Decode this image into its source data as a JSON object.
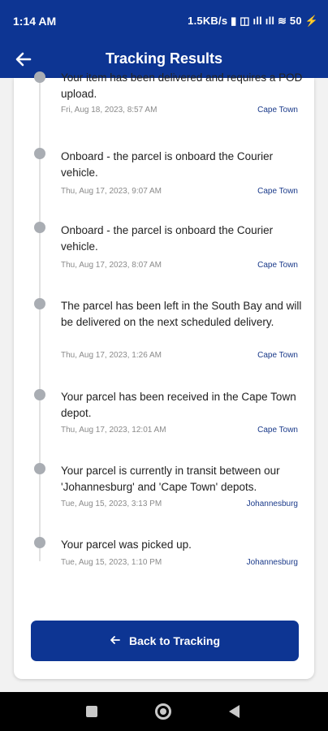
{
  "status": {
    "time": "1:14 AM",
    "right": "1.5KB/s  ▮  ◫ ıll ıll ≋ 50 ⚡"
  },
  "header": {
    "title": "Tracking Results"
  },
  "events": [
    {
      "description": "Your item has been delivered and requires a POD upload.",
      "date": "Fri, Aug 18, 2023, 8:57 AM",
      "location": "Cape Town"
    },
    {
      "description": "Onboard - the parcel is onboard the Courier vehicle.",
      "date": "Thu, Aug 17, 2023, 9:07 AM",
      "location": "Cape Town"
    },
    {
      "description": "Onboard - the parcel is onboard the Courier vehicle.",
      "date": "Thu, Aug 17, 2023, 8:07 AM",
      "location": "Cape Town"
    },
    {
      "description": "The parcel has been left in the South Bay and will be delivered on the next scheduled delivery.",
      "date": "Thu, Aug 17, 2023, 1:26 AM",
      "location": "Cape Town"
    },
    {
      "description": "Your parcel has been received in the Cape Town depot.",
      "date": "Thu, Aug 17, 2023, 12:01 AM",
      "location": "Cape Town"
    },
    {
      "description": "Your parcel is currently in transit between our 'Johannesburg' and 'Cape Town' depots.",
      "date": "Tue, Aug 15, 2023, 3:13 PM",
      "location": "Johannesburg"
    },
    {
      "description": "Your parcel was picked up.",
      "date": "Tue, Aug 15, 2023, 1:10 PM",
      "location": "Johannesburg"
    }
  ],
  "actions": {
    "back_label": "Back to Tracking"
  },
  "colors": {
    "brand": "#0d3593",
    "location": "#1a3a8a",
    "dot": "#a9adb3"
  }
}
